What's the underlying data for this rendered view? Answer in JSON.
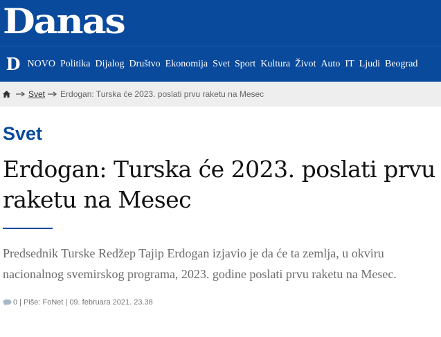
{
  "masthead": {
    "logo": "Danas"
  },
  "nav": {
    "logo_letter": "D",
    "items": [
      "NOVO",
      "Politika",
      "Dijalog",
      "Društvo",
      "Ekonomija",
      "Svet",
      "Sport",
      "Kultura",
      "Život",
      "Auto",
      "IT",
      "Ljudi",
      "Beograd"
    ]
  },
  "breadcrumb": {
    "home_icon": "home-icon",
    "section": "Svet",
    "current": "Erdogan: Turska će 2023. poslati prvu raketu na Mesec"
  },
  "article": {
    "section": "Svet",
    "title": "Erdogan: Turska će 2023. poslati prvu raketu na Mesec",
    "lead": "Predsednik Turske Redžep Tajip Erdogan izjavio je da će ta zemlja, u okviru nacionalnog svemirskog programa, 2023. godine poslati prvu raketu na Mesec.",
    "comments_count": "0",
    "separator": "|",
    "author": "Piše: FoNet",
    "date": "09. februara 2021. 23.38"
  },
  "colors": {
    "brand": "#0a4a9c",
    "breadcrumb_bg": "#eeeeee"
  }
}
